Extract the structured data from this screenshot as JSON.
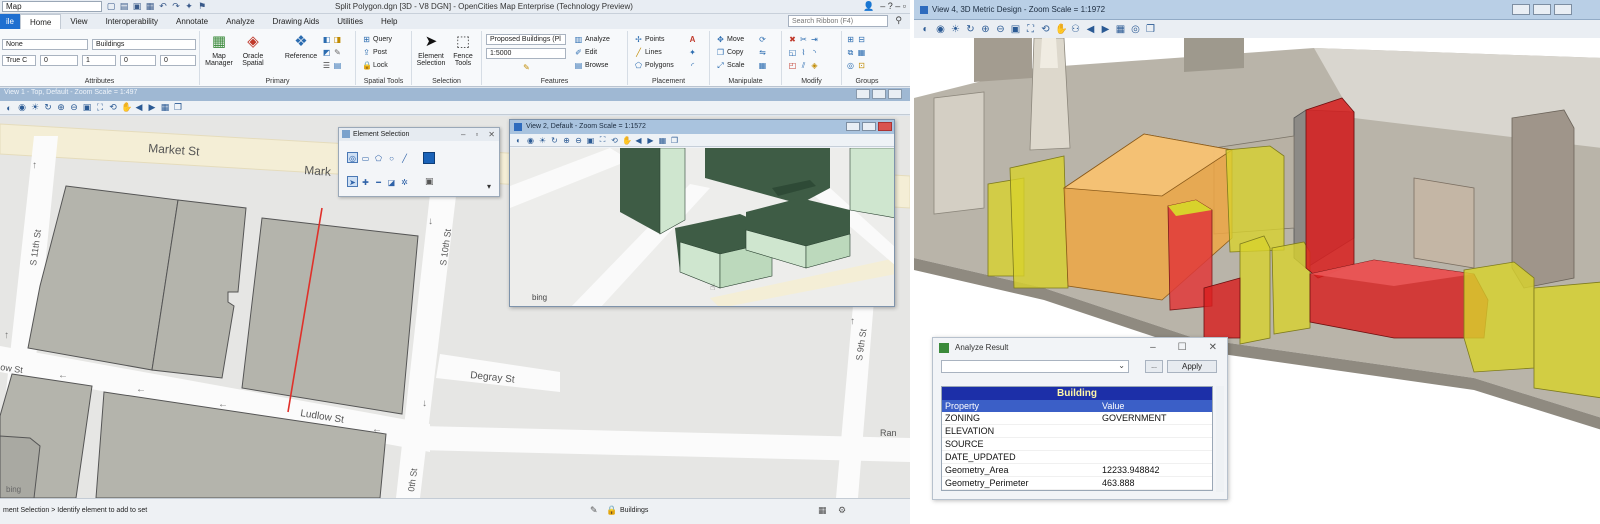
{
  "left": {
    "titlebar": {
      "workflow": "Map",
      "title": "Split Polygon.dgn [3D - V8 DGN] - OpenCities Map Enterprise (Technology Preview)",
      "controls": "–  ?  –  ▫"
    },
    "menu": {
      "tabs": [
        "ile",
        "Home",
        "View",
        "Interoperability",
        "Annotate",
        "Analyze",
        "Drawing Aids",
        "Utilities",
        "Help"
      ],
      "search_placeholder": "Search Ribbon (F4)"
    },
    "ribbon": {
      "attributes": {
        "label": "Attributes",
        "level_none": "None",
        "level_buildings": "Buildings",
        "color": "True C",
        "weight": "0",
        "style": "1",
        "trans": "0",
        "priority": "0"
      },
      "primary": {
        "label": "Primary",
        "map_manager": "Map Manager",
        "oracle_spatial": "Oracle Spatial",
        "reference": "Reference"
      },
      "spatial_tools": {
        "label": "Spatial Tools",
        "query": "Query",
        "post": "Post",
        "lock": "Lock"
      },
      "selection": {
        "label": "Selection",
        "element_selection": "Element Selection",
        "fence_tools": "Fence Tools"
      },
      "features": {
        "label": "Features",
        "feature_combo": "Proposed Buildings (Pl",
        "scale_combo": "1:5000",
        "analyze": "Analyze",
        "edit": "Edit",
        "browse": "Browse"
      },
      "placement": {
        "label": "Placement",
        "points": "Points",
        "lines": "Lines",
        "polygons": "Polygons"
      },
      "manipulate": {
        "label": "Manipulate",
        "move": "Move",
        "copy": "Copy",
        "scale": "Scale"
      },
      "modify": {
        "label": "Modify"
      },
      "groups": {
        "label": "Groups"
      }
    },
    "view1": {
      "title": "View 1 - Top, Default - Zoom Scale = 1:497",
      "streets": {
        "market": "Market St",
        "market2": "Mark",
        "s11": "S 11th St",
        "s10": "S 10th St",
        "s9": "S 9th St",
        "s10b": "0th St",
        "ludlow": "Ludlow St",
        "degray": "Degray St",
        "ran": "Ran",
        "ow": "ow St"
      },
      "bing": "bing"
    },
    "element_selection_dialog": {
      "title": "Element Selection"
    },
    "view2": {
      "title": "View 2, Default - Zoom Scale = 1:1572",
      "bing": "bing"
    },
    "status": {
      "prompt": "ment Selection > Identify element to add to set",
      "level": "Buildings"
    }
  },
  "right": {
    "view4": {
      "title": "View 4, 3D Metric Design - Zoom Scale = 1:1972"
    },
    "analyze_result": {
      "title": "Analyze Result",
      "dots": "...",
      "apply": "Apply",
      "grid_title": "Building",
      "col_property": "Property",
      "col_value": "Value",
      "rows": [
        {
          "property": "ZONING",
          "value": "GOVERNMENT"
        },
        {
          "property": "ELEVATION",
          "value": ""
        },
        {
          "property": "SOURCE",
          "value": ""
        },
        {
          "property": "DATE_UPDATED",
          "value": ""
        },
        {
          "property": "Geometry_Area",
          "value": "12233.948842"
        },
        {
          "property": "Geometry_Perimeter",
          "value": "463.888"
        }
      ]
    }
  },
  "colors": {
    "file_tab": "#1f6fd0",
    "map_bg": "#e4e4e2",
    "parcel_fill": "#b2b2aa",
    "split_line": "#e0302a",
    "building_green": "#3e5c45",
    "building_face": "#cfe6cf",
    "grid_header": "#1c2fa8",
    "highlight_red": "#d81f1f",
    "highlight_yellow": "#d8d22c",
    "highlight_orange": "#f0a640"
  }
}
